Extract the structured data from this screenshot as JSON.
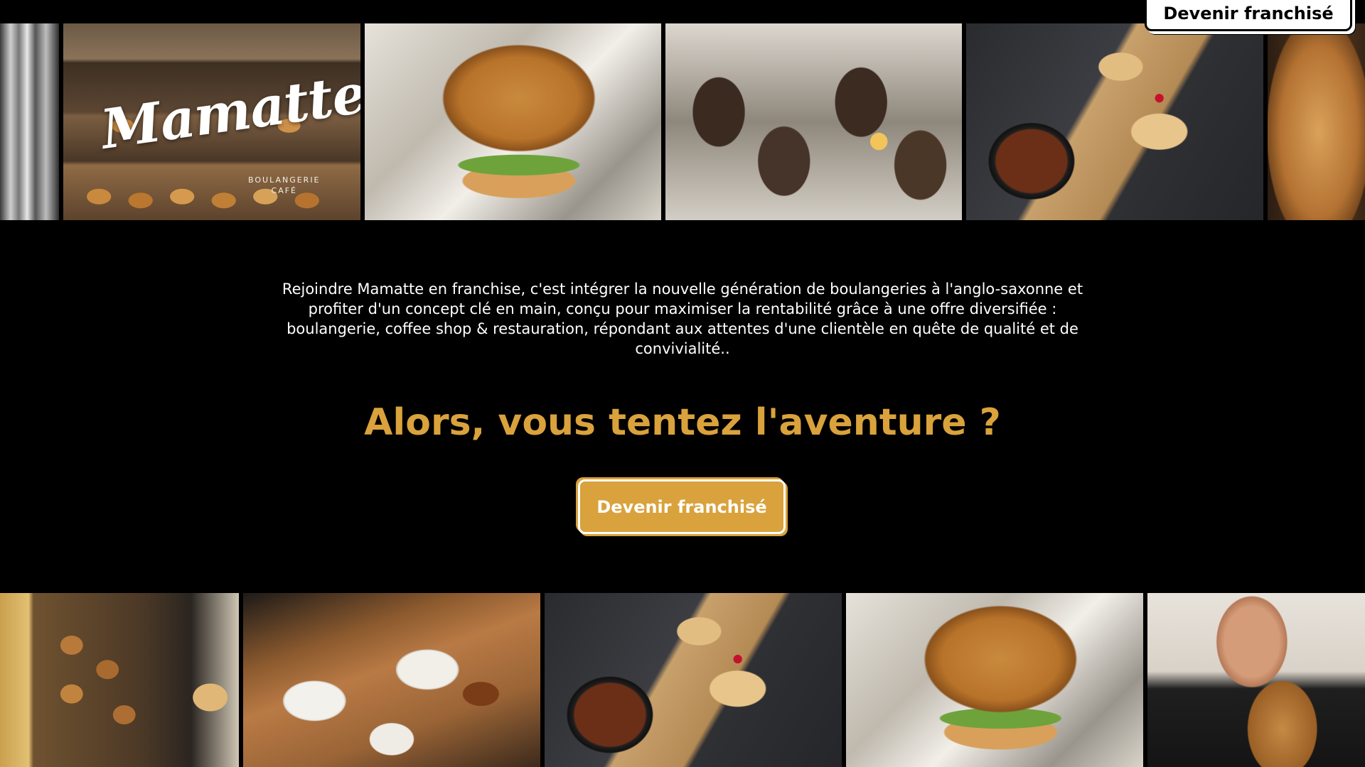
{
  "header": {
    "cta_label": "Devenir franchisé"
  },
  "gallery_top": {
    "logo": {
      "name": "Mamatte",
      "sub_line1": "BOULANGERIE",
      "sub_line2": "CAFÉ"
    },
    "tiles": [
      "chrome-machine",
      "bakery-shelves-logo",
      "burger",
      "sandwiches",
      "pancakes",
      "bread-loaf"
    ]
  },
  "main": {
    "intro": "Rejoindre Mamatte en franchise, c'est intégrer la nouvelle génération de boulangeries à l'anglo-saxonne et profiter d'un concept clé en main, conçu pour maximiser la rentabilité grâce à une offre diversifiée : boulangerie, coffee shop & restauration, répondant aux attentes d'une clientèle en quête de qualité et de convivialité..",
    "headline": "Alors, vous tentez l'aventure ?",
    "cta_label": "Devenir franchisé"
  },
  "gallery_bottom": {
    "tiles": [
      "cookies-pastries",
      "brunch-table",
      "pancakes",
      "burger",
      "man-eating-bread"
    ]
  },
  "colors": {
    "accent": "#d9a23c",
    "background": "#000000",
    "text": "#ffffff"
  }
}
